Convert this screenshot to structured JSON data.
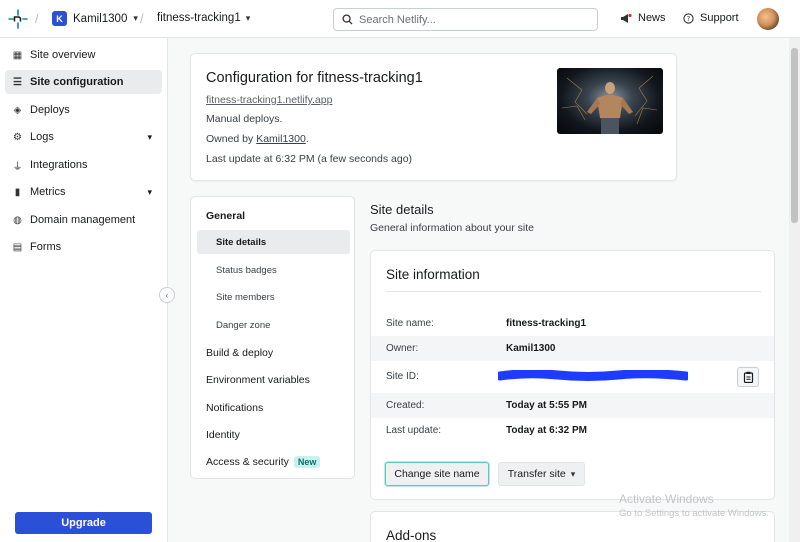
{
  "topbar": {
    "team_initial": "K",
    "team_name": "Kamil1300",
    "site_name": "fitness-tracking1",
    "search_placeholder": "Search Netlify...",
    "news_label": "News",
    "support_label": "Support"
  },
  "sidebar": {
    "items": [
      {
        "label": "Site overview",
        "icon": "grid-icon"
      },
      {
        "label": "Site configuration",
        "icon": "sliders-icon"
      },
      {
        "label": "Deploys",
        "icon": "layers-icon"
      },
      {
        "label": "Logs",
        "icon": "gear-icon"
      },
      {
        "label": "Integrations",
        "icon": "plug-icon"
      },
      {
        "label": "Metrics",
        "icon": "bar-chart-icon"
      },
      {
        "label": "Domain management",
        "icon": "globe-icon"
      },
      {
        "label": "Forms",
        "icon": "form-icon"
      }
    ],
    "upgrade_label": "Upgrade"
  },
  "config": {
    "title": "Configuration for fitness-tracking1",
    "url": "fitness-tracking1.netlify.app",
    "deploy_mode": "Manual deploys.",
    "owned_prefix": "Owned by ",
    "owner": "Kamil1300",
    "owned_suffix": ".",
    "last_update": "Last update at 6:32 PM (a few seconds ago)"
  },
  "settings_nav": {
    "general": "General",
    "site_details": "Site details",
    "status_badges": "Status badges",
    "site_members": "Site members",
    "danger_zone": "Danger zone",
    "build_deploy": "Build & deploy",
    "env_vars": "Environment variables",
    "notifications": "Notifications",
    "identity": "Identity",
    "access_security": "Access & security",
    "new_badge": "New"
  },
  "site_details": {
    "title": "Site details",
    "subtitle": "General information about your site",
    "card_title": "Site information",
    "rows": {
      "name_label": "Site name:",
      "name_value": "fitness-tracking1",
      "owner_label": "Owner:",
      "owner_value": "Kamil1300",
      "id_label": "Site ID:",
      "created_label": "Created:",
      "created_value": "Today at 5:55 PM",
      "update_label": "Last update:",
      "update_value": "Today at 6:32 PM"
    },
    "change_name_label": "Change site name",
    "transfer_label": "Transfer site"
  },
  "addons": {
    "title": "Add-ons"
  },
  "watermark": {
    "line1": "Activate Windows",
    "line2": "Go to Settings to activate Windows."
  },
  "colors": {
    "brand_blue": "#2b4fd7",
    "teal_focus": "#5cc9c0",
    "redaction_blue": "#1e3cff"
  }
}
